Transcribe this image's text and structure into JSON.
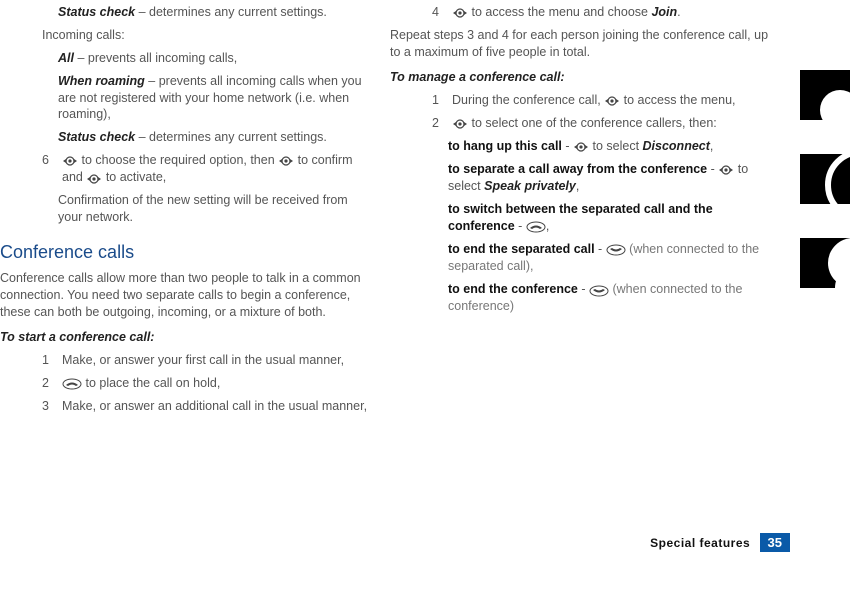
{
  "col1": {
    "status_check1": {
      "label": "Status check",
      "desc": " – determines any current settings."
    },
    "incoming_calls": "Incoming calls:",
    "all": {
      "label": "All",
      "desc": " – prevents all incoming calls,"
    },
    "when_roaming": {
      "label": "When roaming",
      "desc": " – prevents all incoming calls when you are not registered with your home network (i.e. when roaming),"
    },
    "status_check2": {
      "label": "Status check",
      "desc": " – determines any current settings."
    },
    "step6_pre": "6",
    "step6_a": " to choose the required option, then ",
    "step6_b": " to confirm and ",
    "step6_c": " to activate,",
    "step6_conf": "Confirmation of the new setting will be received from your network.",
    "section": "Conference calls",
    "section_desc": "Conference calls allow more than two people to talk in a common connection. You need two separate calls to begin a conference, these can both be outgoing, incoming, or a mixture of both.",
    "start_h": "To start a conference call:",
    "s1": {
      "n": "1",
      "t": "Make, or answer your first call in the usual manner,"
    },
    "s2": {
      "n": "2",
      "t_after": " to place the call on hold,"
    },
    "s3": {
      "n": "3",
      "t": "Make, or answer an additional call in the usual manner,"
    }
  },
  "col2": {
    "s4": {
      "n": "4",
      "t_a": " to access the menu and choose ",
      "join": "Join",
      "t_b": "."
    },
    "repeat": "Repeat steps 3 and 4 for each person joining the conference call, up to a maximum of five people in total.",
    "manage_h": "To manage a conference call:",
    "m1": {
      "n": "1",
      "t_a": "During the conference call, ",
      "t_b": " to access the menu,"
    },
    "m2": {
      "n": "2",
      "t_a": " to select one of the conference callers, then:"
    },
    "hang": {
      "b": "to hang up this call",
      "mid": " - ",
      "tail": " to select ",
      "disc": "Disconnect",
      "end": ","
    },
    "sep": {
      "b": "to separate a call away from the conference",
      "mid": " - ",
      "tail": "to select ",
      "sp": "Speak privately",
      "end": ","
    },
    "switch": {
      "b": "to switch between the separated call and the conference",
      "mid": " - ",
      "end": ","
    },
    "endsep": {
      "b": "to end the separated call",
      "mid": " - ",
      "tail": " (when connected to the separated call),"
    },
    "endconf": {
      "b": "to end the conference",
      "mid": " - ",
      "tail": " (when connected to the conference)"
    }
  },
  "footer": {
    "label": "Special features",
    "page": "35"
  }
}
